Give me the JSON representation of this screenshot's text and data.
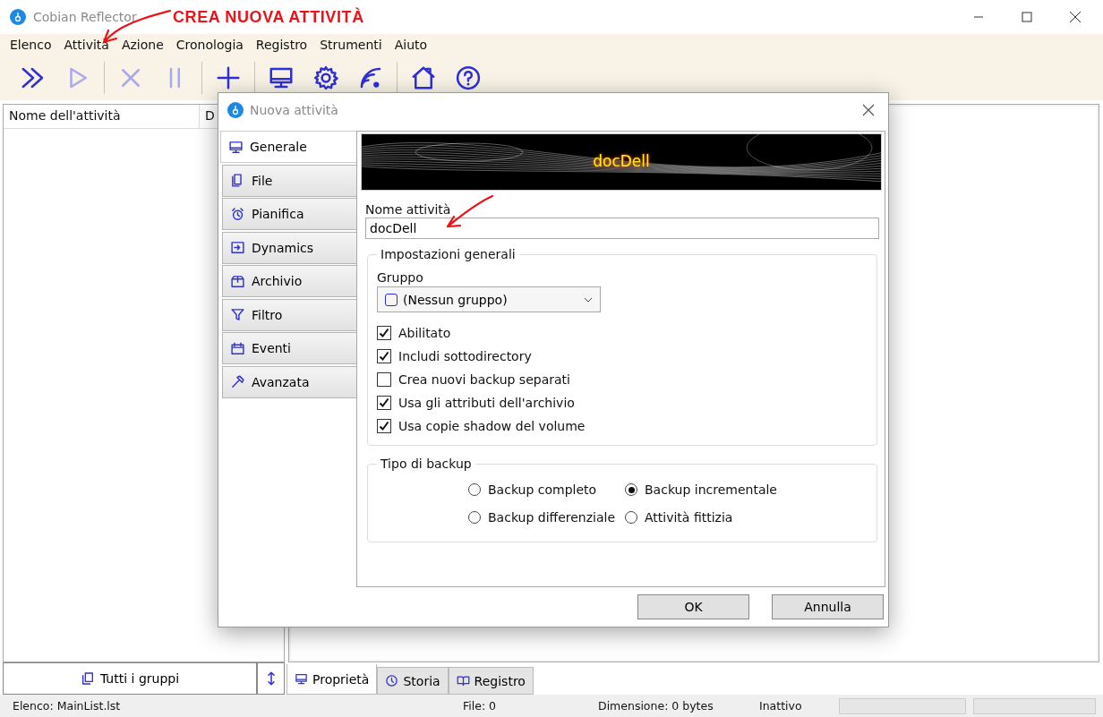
{
  "window": {
    "title": "Cobian Reflector"
  },
  "annotation": {
    "text": "CREA NUOVA ATTIVITÀ"
  },
  "menu": [
    "Elenco",
    "Attività",
    "Azione",
    "Cronologia",
    "Registro",
    "Strumenti",
    "Aiuto"
  ],
  "toolbar": [
    {
      "kind": "button",
      "disabled": false
    },
    {
      "kind": "button",
      "disabled": true
    },
    {
      "kind": "separator"
    },
    {
      "kind": "button",
      "disabled": true
    },
    {
      "kind": "button",
      "disabled": true
    },
    {
      "kind": "separator"
    },
    {
      "kind": "button",
      "disabled": false
    },
    {
      "kind": "separator"
    },
    {
      "kind": "button",
      "disabled": false
    },
    {
      "kind": "button",
      "disabled": false
    },
    {
      "kind": "button",
      "disabled": false
    },
    {
      "kind": "separator"
    },
    {
      "kind": "button",
      "disabled": false
    },
    {
      "kind": "button",
      "disabled": false
    }
  ],
  "task_list": {
    "columns": [
      "Nome dell'attività",
      "D"
    ]
  },
  "group_button": "Tutti i gruppi",
  "bottom_tabs": [
    {
      "label": "Proprietà",
      "selected": true
    },
    {
      "label": "Storia",
      "selected": false
    },
    {
      "label": "Registro",
      "selected": false
    }
  ],
  "status_bar": [
    "Elenco: MainList.lst",
    "File: 0",
    "Dimensione: 0 bytes",
    "Inattivo"
  ],
  "progress_bars": [
    {
      "level": 0
    },
    {
      "level": 0
    }
  ],
  "dialog": {
    "title": "Nuova attività",
    "tabs": [
      {
        "label": "Generale",
        "selected": true
      },
      {
        "label": "File",
        "selected": false
      },
      {
        "label": "Pianifica",
        "selected": false
      },
      {
        "label": "Dynamics",
        "selected": false
      },
      {
        "label": "Archivio",
        "selected": false
      },
      {
        "label": "Filtro",
        "selected": false
      },
      {
        "label": "Eventi",
        "selected": false
      },
      {
        "label": "Avanzata",
        "selected": false
      }
    ],
    "banner_text": "docDell",
    "name_label": "Nome attività",
    "name_value": "docDell",
    "general": {
      "legend": "Impostazioni generali",
      "group_label": "Gruppo",
      "group_value": "(Nessun gruppo)",
      "options": [
        {
          "label": "Abilitato",
          "checked": true
        },
        {
          "label": "Includi sottodirectory",
          "checked": true
        },
        {
          "label": "Crea nuovi backup separati",
          "checked": false
        },
        {
          "label": "Usa gli attributi dell'archivio",
          "checked": true
        },
        {
          "label": "Usa copie shadow del volume",
          "checked": true
        }
      ]
    },
    "backup_type": {
      "legend": "Tipo di backup",
      "options": [
        {
          "label": "Backup completo",
          "selected": false
        },
        {
          "label": "Backup incrementale",
          "selected": true
        },
        {
          "label": "Backup differenziale",
          "selected": false
        },
        {
          "label": "Attività fittizia",
          "selected": false
        }
      ]
    },
    "buttons": [
      "OK",
      "Annulla"
    ]
  }
}
